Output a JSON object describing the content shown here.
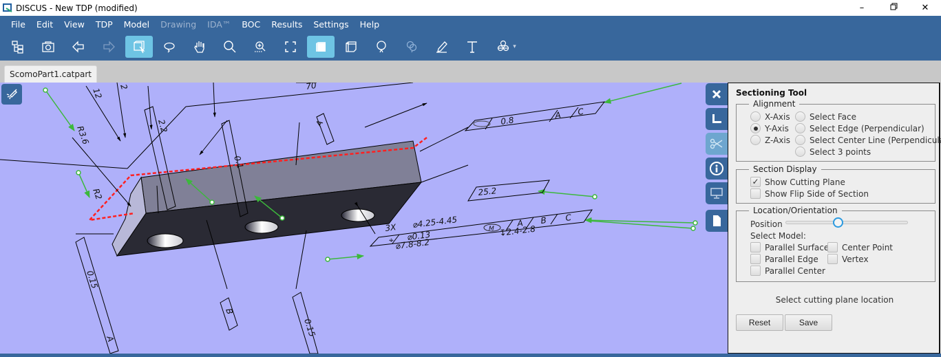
{
  "window": {
    "title": "DISCUS - New TDP (modified)",
    "controls": {
      "minimize": "–",
      "restore": "🗗",
      "close": "✕"
    }
  },
  "menu": {
    "items": [
      {
        "label": "File",
        "enabled": true
      },
      {
        "label": "Edit",
        "enabled": true
      },
      {
        "label": "View",
        "enabled": true
      },
      {
        "label": "TDP",
        "enabled": true
      },
      {
        "label": "Model",
        "enabled": true
      },
      {
        "label": "Drawing",
        "enabled": false
      },
      {
        "label": "IDA™",
        "enabled": false
      },
      {
        "label": "BOC",
        "enabled": true
      },
      {
        "label": "Results",
        "enabled": true
      },
      {
        "label": "Settings",
        "enabled": true
      },
      {
        "label": "Help",
        "enabled": true
      }
    ]
  },
  "toolbar": {
    "buttons": [
      {
        "icon": "tree-structure-icon",
        "active": false
      },
      {
        "icon": "camera-icon",
        "active": false
      },
      {
        "icon": "back-arrow-icon",
        "active": false
      },
      {
        "icon": "forward-arrow-icon",
        "active": false,
        "disabled": true
      },
      {
        "icon": "box-select-icon",
        "active": true
      },
      {
        "icon": "rotate-icon",
        "active": false
      },
      {
        "icon": "pan-hand-icon",
        "active": false
      },
      {
        "icon": "zoom-icon",
        "active": false
      },
      {
        "icon": "zoom-area-icon",
        "active": false
      },
      {
        "icon": "fit-all-icon",
        "active": false
      },
      {
        "icon": "shaded-view-icon",
        "active": true
      },
      {
        "icon": "wireframe-view-icon",
        "active": false
      },
      {
        "icon": "balloon-icon",
        "active": false
      },
      {
        "icon": "multi-balloon-icon",
        "active": false,
        "disabled": true
      },
      {
        "icon": "pencil-icon",
        "active": false
      },
      {
        "icon": "text-icon",
        "active": false
      },
      {
        "icon": "assembly-icon",
        "active": false,
        "has_dropdown": true
      }
    ]
  },
  "document_tabs": [
    {
      "label": "ScomoPart1.catpart",
      "active": true
    }
  ],
  "viewport": {
    "tool_icon": "flashlight-icon",
    "annotations": {
      "top_dim": "70",
      "dim_12": "12",
      "dim_2": "2",
      "dim_22": "2.2",
      "radius_36": "R3.6",
      "radius_2": "R2",
      "flatness_value": "0.1",
      "datum_a": "A",
      "datum_b": "B",
      "profile_value": "0.8",
      "profile_datums": [
        "A",
        "C"
      ],
      "dim_252": "25.2",
      "position_count": "3X",
      "hole_dia": "⌀4.25-4.45",
      "position_tol": "⌀0.13",
      "modifier": "M",
      "position_datums": [
        "A",
        "B",
        "C"
      ],
      "depth": "↧2.4-2.8",
      "cbore_dia": "⌀7.8-8.2",
      "perp_left": "0.15",
      "perp_left_datum": "A",
      "perp_right": "0.15"
    }
  },
  "side_rail": {
    "buttons": [
      {
        "icon": "close-icon",
        "active": false
      },
      {
        "icon": "ruler-measure-icon",
        "active": false
      },
      {
        "icon": "scissors-section-icon",
        "active": true
      },
      {
        "icon": "info-icon",
        "active": false
      },
      {
        "icon": "monitor-icon",
        "active": false
      },
      {
        "icon": "document-icon",
        "active": false
      }
    ]
  },
  "sectioning_panel": {
    "title": "Sectioning Tool",
    "alignment": {
      "legend": "Alignment",
      "axes": [
        {
          "label": "X-Axis",
          "checked": false
        },
        {
          "label": "Y-Axis",
          "checked": true
        },
        {
          "label": "Z-Axis",
          "checked": false
        }
      ],
      "selections": [
        {
          "label": "Select Face",
          "checked": false
        },
        {
          "label": "Select Edge (Perpendicular)",
          "checked": false
        },
        {
          "label": "Select Center Line (Perpendicular)",
          "checked": false
        },
        {
          "label": "Select 3 points",
          "checked": false
        }
      ]
    },
    "section_display": {
      "legend": "Section Display",
      "options": [
        {
          "label": "Show Cutting Plane",
          "checked": true
        },
        {
          "label": "Show Flip Side of Section",
          "checked": false
        }
      ]
    },
    "location": {
      "legend": "Location/Orientation",
      "position_label": "Position",
      "position_value": 0.43,
      "select_model_label": "Select Model:",
      "options_left": [
        {
          "label": "Parallel Surface",
          "checked": false
        },
        {
          "label": "Parallel Edge",
          "checked": false
        },
        {
          "label": "Parallel Center",
          "checked": false
        }
      ],
      "options_right": [
        {
          "label": "Center Point",
          "checked": false
        },
        {
          "label": "Vertex",
          "checked": false
        }
      ]
    },
    "status": "Select cutting plane location",
    "reset_label": "Reset",
    "save_label": "Save"
  },
  "colors": {
    "brand": "#38679c",
    "active_tool": "#6ec4e4",
    "viewport_bg": "#afb0fa",
    "cutting_plane": "#ff2020",
    "leader_green": "#3cb83c",
    "slider_accent": "#2b9ae0"
  }
}
